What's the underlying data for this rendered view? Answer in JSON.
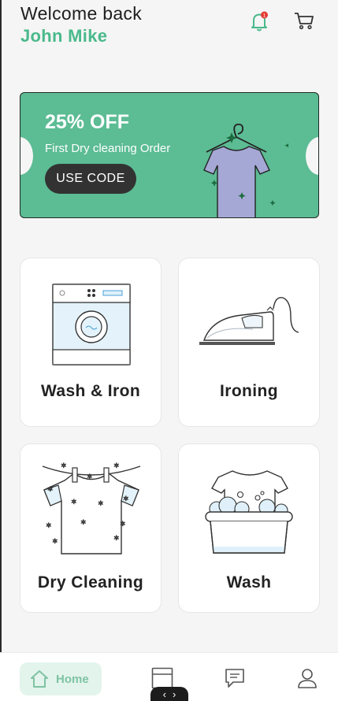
{
  "header": {
    "greeting": "Welcome back",
    "username": "John Mike",
    "notification_count": "1"
  },
  "promo": {
    "title": "25% OFF",
    "subtitle": "First Dry cleaning Order",
    "button_label": "USE CODE"
  },
  "services": [
    {
      "label": "Wash & Iron",
      "icon": "washing-machine-icon"
    },
    {
      "label": "Ironing",
      "icon": "iron-icon"
    },
    {
      "label": "Dry Cleaning",
      "icon": "shirt-on-line-icon"
    },
    {
      "label": "Wash",
      "icon": "wash-basin-icon"
    }
  ],
  "nav": {
    "home_label": "Home",
    "items": [
      "home-icon",
      "orders-icon",
      "chat-icon",
      "profile-icon"
    ]
  },
  "colors": {
    "accent": "#4ab98b",
    "promo_bg": "#5cbc94",
    "nav_active_bg": "#e3f4ec",
    "shirt": "#a5a8d4"
  },
  "handle": {
    "left": "‹",
    "right": "›"
  }
}
